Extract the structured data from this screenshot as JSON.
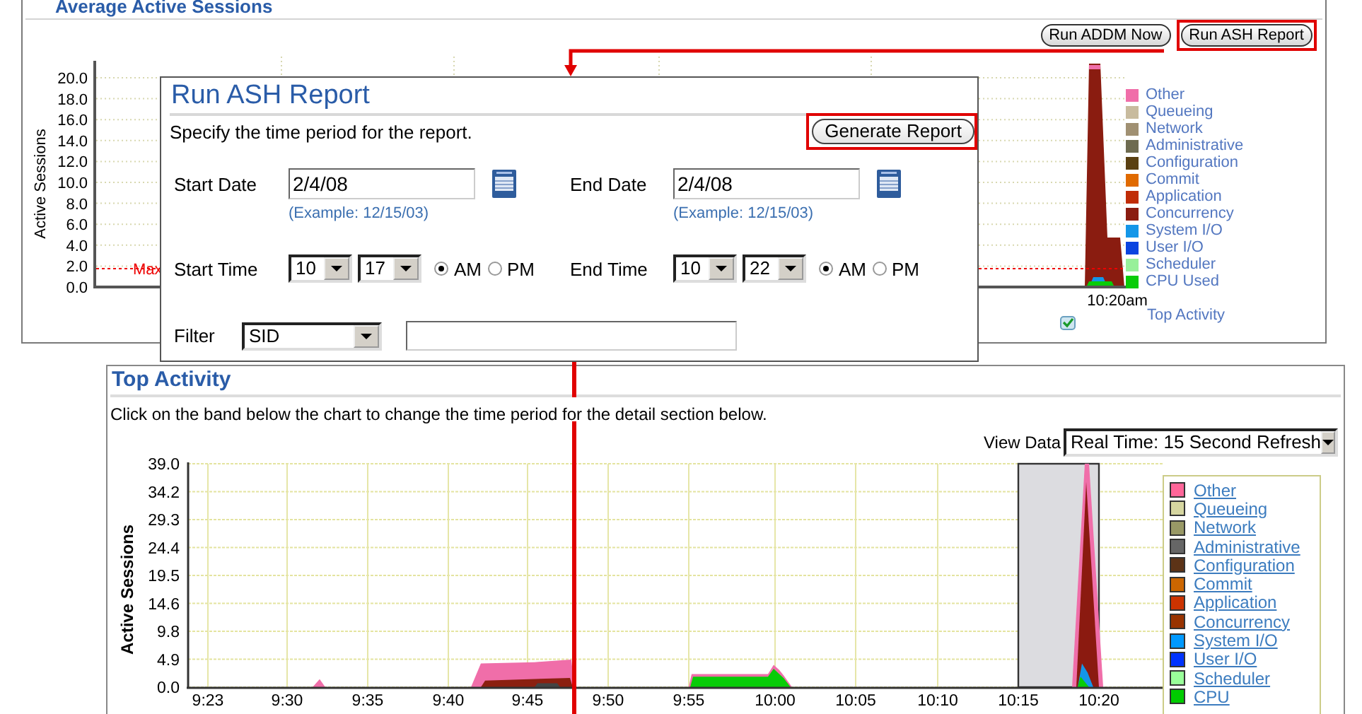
{
  "average_active_sessions": {
    "title": "Average Active Sessions",
    "buttons": [
      {
        "label": "Run ADDM Now",
        "highlighted": false
      },
      {
        "label": "Run ASH Report",
        "highlighted": true
      }
    ],
    "chart": {
      "ylabel": "Active Sessions",
      "yticks": [
        "20.0",
        "18.0",
        "16.0",
        "14.0",
        "12.0",
        "10.0",
        "8.0",
        "6.0",
        "4.0",
        "2.0",
        "0.0"
      ],
      "xticks": [
        "10:20am"
      ],
      "max_label": "Max"
    },
    "legend": [
      {
        "label": "Other",
        "color": "#f06ea9"
      },
      {
        "label": "Queueing",
        "color": "#c8bb9e"
      },
      {
        "label": "Network",
        "color": "#a09072"
      },
      {
        "label": "Administrative",
        "color": "#6e6b50"
      },
      {
        "label": "Configuration",
        "color": "#5a4012"
      },
      {
        "label": "Commit",
        "color": "#e06a00"
      },
      {
        "label": "Application",
        "color": "#c02c06"
      },
      {
        "label": "Concurrency",
        "color": "#8a1c10"
      },
      {
        "label": "System I/O",
        "color": "#1496e8"
      },
      {
        "label": "User I/O",
        "color": "#0a44e0"
      },
      {
        "label": "Scheduler",
        "color": "#98f09a"
      },
      {
        "label": "CPU Used",
        "color": "#08cc08"
      }
    ],
    "link": "Top Activity"
  },
  "ash_dialog": {
    "title": "Run ASH Report",
    "instruction": "Specify the time period for the report.",
    "generate_button": {
      "label": "Generate Report",
      "highlighted": true
    },
    "start_date": {
      "label": "Start Date",
      "value": "2/4/08",
      "example": "(Example: 12/15/03)"
    },
    "end_date": {
      "label": "End Date",
      "value": "2/4/08",
      "example": "(Example: 12/15/03)"
    },
    "start_time": {
      "label": "Start Time",
      "hour": "10",
      "minute": "17",
      "am_pm": [
        {
          "label": "AM",
          "selected": true
        },
        {
          "label": "PM",
          "selected": false
        }
      ]
    },
    "end_time": {
      "label": "End Time",
      "hour": "10",
      "minute": "22",
      "am_pm": [
        {
          "label": "AM",
          "selected": true
        },
        {
          "label": "PM",
          "selected": false
        }
      ]
    },
    "filter": {
      "label": "Filter",
      "option": "SID"
    }
  },
  "top_activity": {
    "title": "Top Activity",
    "description": "Click on the band below the chart to change the time period for the detail section below.",
    "view_data": {
      "label": "View Data",
      "value": "Real Time: 15 Second Refresh"
    },
    "chart": {
      "ylabel": "Active Sessions",
      "yticks": [
        "39.0",
        "34.2",
        "29.3",
        "24.4",
        "19.5",
        "14.6",
        "9.8",
        "4.9",
        "0.0"
      ],
      "xticks": [
        "9:23",
        "9:30",
        "9:35",
        "9:40",
        "9:45",
        "9:50",
        "9:55",
        "10:00",
        "10:05",
        "10:10",
        "10:15",
        "10:20"
      ]
    },
    "legend": [
      {
        "label": "Other",
        "color": "#ff6699"
      },
      {
        "label": "Queueing",
        "color": "#d6d6a0"
      },
      {
        "label": "Network",
        "color": "#999966"
      },
      {
        "label": "Administrative",
        "color": "#666666"
      },
      {
        "label": "Configuration",
        "color": "#5c3317"
      },
      {
        "label": "Commit",
        "color": "#cc6600"
      },
      {
        "label": "Application",
        "color": "#cc3300"
      },
      {
        "label": "Concurrency",
        "color": "#993300"
      },
      {
        "label": "System I/O",
        "color": "#0099ff"
      },
      {
        "label": "User I/O",
        "color": "#0033ff"
      },
      {
        "label": "Scheduler",
        "color": "#99ff99"
      },
      {
        "label": "CPU",
        "color": "#00cc00"
      }
    ]
  }
}
